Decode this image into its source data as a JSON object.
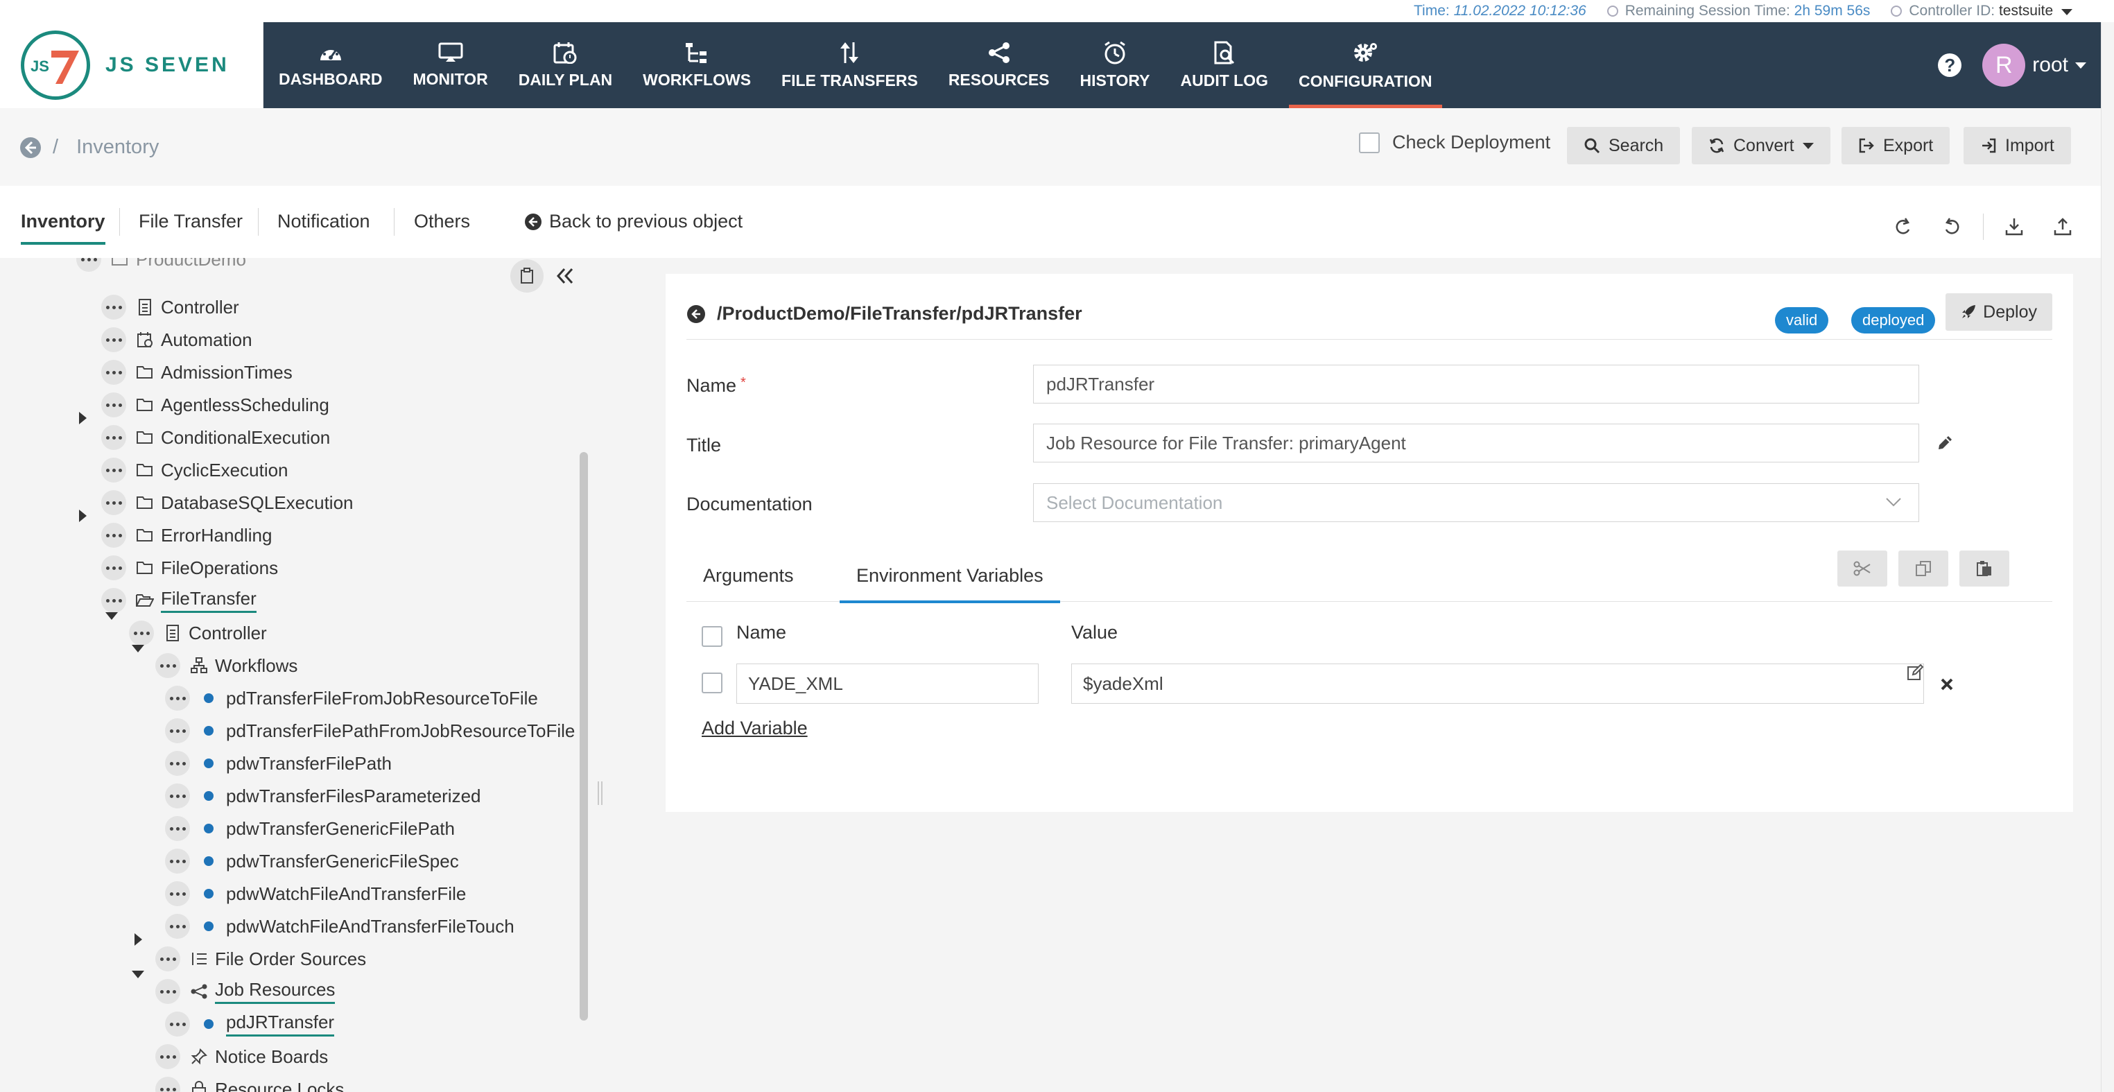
{
  "status": {
    "time_label": "Time:",
    "time_value": "11.02.2022 10:12:36",
    "session_label": "Remaining Session Time:",
    "session_value": "2h 59m 56s",
    "controller_label": "Controller ID:",
    "controller_value": "testsuite"
  },
  "logo": {
    "mark": "JS",
    "text": "JS SEVEN"
  },
  "nav": {
    "items": [
      {
        "label": "DASHBOARD",
        "icon": "dashboard-icon"
      },
      {
        "label": "MONITOR",
        "icon": "monitor-icon"
      },
      {
        "label": "DAILY PLAN",
        "icon": "calendar-icon"
      },
      {
        "label": "WORKFLOWS",
        "icon": "workflow-icon"
      },
      {
        "label": "FILE TRANSFERS",
        "icon": "transfer-icon"
      },
      {
        "label": "RESOURCES",
        "icon": "share-icon"
      },
      {
        "label": "HISTORY",
        "icon": "clock-icon"
      },
      {
        "label": "AUDIT LOG",
        "icon": "audit-icon"
      },
      {
        "label": "CONFIGURATION",
        "icon": "gear-icon",
        "active": true
      }
    ],
    "help": "?",
    "avatar_initial": "R",
    "user": "root",
    "active_color": "#e8634a",
    "bg_color": "#2c3e50"
  },
  "header": {
    "breadcrumb": "Inventory",
    "check_deployment": "Check Deployment",
    "buttons": {
      "search": "Search",
      "convert": "Convert",
      "export": "Export",
      "import": "Import"
    }
  },
  "tabs": {
    "items": [
      "Inventory",
      "File Transfer",
      "Notification",
      "Others"
    ],
    "back": "Back to previous object"
  },
  "tree": {
    "cut_label": "ProductDemo",
    "items": [
      {
        "label": "Controller"
      },
      {
        "label": "Automation"
      },
      {
        "label": "AdmissionTimes"
      },
      {
        "label": "AgentlessScheduling"
      },
      {
        "label": "ConditionalExecution"
      },
      {
        "label": "CyclicExecution"
      },
      {
        "label": "DatabaseSQLExecution"
      },
      {
        "label": "ErrorHandling"
      },
      {
        "label": "FileOperations"
      },
      {
        "label": "FileTransfer"
      },
      {
        "label": "Controller"
      },
      {
        "label": "Workflows"
      },
      {
        "label": "pdTransferFileFromJobResourceToFile"
      },
      {
        "label": "pdTransferFilePathFromJobResourceToFile"
      },
      {
        "label": "pdwTransferFilePath"
      },
      {
        "label": "pdwTransferFilesParameterized"
      },
      {
        "label": "pdwTransferGenericFilePath"
      },
      {
        "label": "pdwTransferGenericFileSpec"
      },
      {
        "label": "pdwWatchFileAndTransferFile"
      },
      {
        "label": "pdwWatchFileAndTransferFileTouch"
      },
      {
        "label": "File Order Sources"
      },
      {
        "label": "Job Resources"
      },
      {
        "label": "pdJRTransfer"
      },
      {
        "label": "Notice Boards"
      },
      {
        "label": "Resource Locks"
      }
    ],
    "accent": "#1b8a7e",
    "bullet_color": "#1e73b8"
  },
  "detail": {
    "path": "/ProductDemo/FileTransfer/pdJRTransfer",
    "badges": {
      "valid": "valid",
      "deployed": "deployed"
    },
    "badge_color": "#1e88d0",
    "deploy": "Deploy",
    "fields": {
      "name_label": "Name",
      "name_required": "*",
      "name_value": "pdJRTransfer",
      "title_label": "Title",
      "title_value": "Job Resource for File Transfer: primaryAgent",
      "doc_label": "Documentation",
      "doc_placeholder": "Select Documentation"
    },
    "subtabs": [
      "Arguments",
      "Environment Variables"
    ],
    "table": {
      "col_name": "Name",
      "col_value": "Value",
      "row_name": "YADE_XML",
      "row_value": "$yadeXml"
    },
    "add_variable": "Add Variable"
  }
}
